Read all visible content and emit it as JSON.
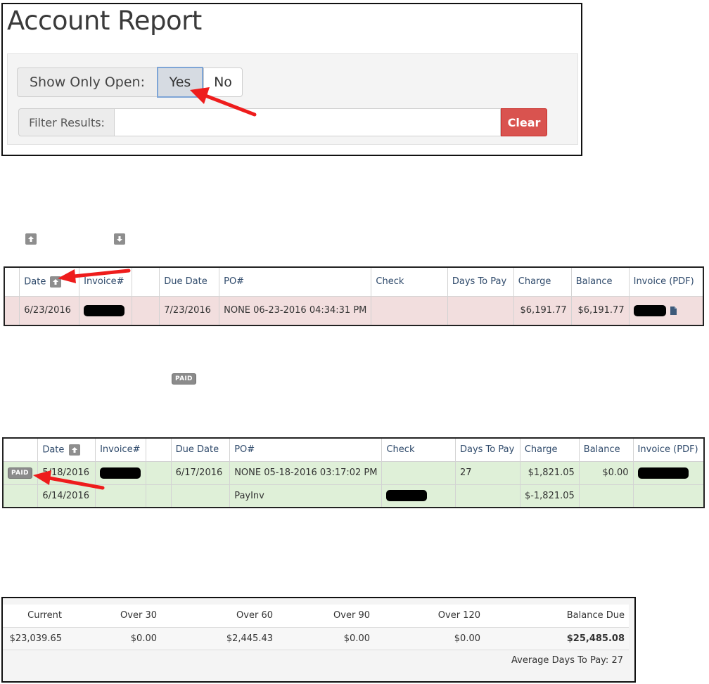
{
  "filter_panel": {
    "title": "Account Report",
    "show_only_open_label": "Show Only Open:",
    "yes_label": "Yes",
    "no_label": "No",
    "filter_label": "Filter Results:",
    "filter_value": "",
    "clear_label": "Clear"
  },
  "colors": {
    "open_row": "#f2dede",
    "paid_row": "#dff0d8",
    "clear_button": "#d9534f",
    "annotation_arrow": "#ee1c1c"
  },
  "icons": [
    "sort-ascending-icon",
    "sort-descending-icon",
    "pdf-file-icon",
    "paid-badge"
  ],
  "legend": {
    "paid_badge": "PAID"
  },
  "columns": [
    "Date",
    "Invoice#",
    "",
    "Due Date",
    "PO#",
    "Check",
    "Days To Pay",
    "Charge",
    "Balance",
    "Invoice (PDF)"
  ],
  "open_invoices": [
    {
      "date": "6/23/2016",
      "due_date": "7/23/2016",
      "po": "NONE 06-23-2016 04:34:31 PM",
      "check": "",
      "days_to_pay": "",
      "charge": "$6,191.77",
      "balance": "$6,191.77"
    }
  ],
  "paid_invoices": [
    {
      "status": "PAID",
      "date": "5/18/2016",
      "due_date": "6/17/2016",
      "po": "NONE 05-18-2016 03:17:02 PM",
      "check": "",
      "days_to_pay": "27",
      "charge": "$1,821.05",
      "balance": "$0.00"
    },
    {
      "status": "",
      "date": "6/14/2016",
      "due_date": "",
      "po": "PayInv",
      "check": "",
      "days_to_pay": "",
      "charge": "$-1,821.05",
      "balance": ""
    }
  ],
  "aging": {
    "headers": [
      "Current",
      "Over 30",
      "Over 60",
      "Over 90",
      "Over 120",
      "Balance Due"
    ],
    "values": [
      "$23,039.65",
      "$0.00",
      "$2,445.43",
      "$0.00",
      "$0.00",
      "$25,485.08"
    ],
    "avg_days_label": "Average Days To Pay:",
    "avg_days_value": "27"
  }
}
